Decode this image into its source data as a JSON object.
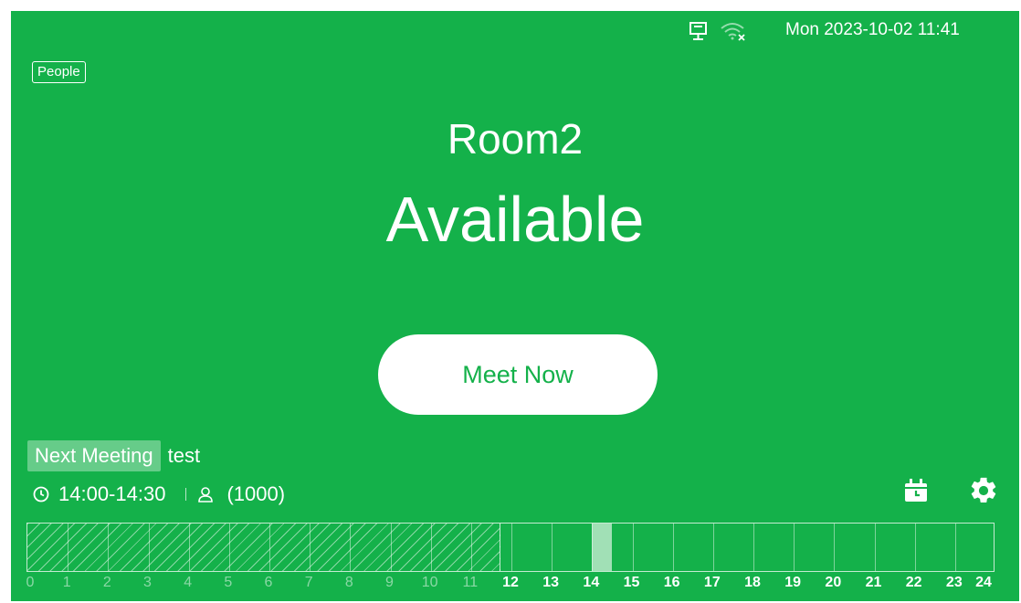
{
  "status": {
    "datetime": "Mon 2023-10-02 11:41",
    "icons": [
      "network-icon",
      "wifi-disconnected-icon"
    ]
  },
  "people_tag": "People",
  "room": {
    "name": "Room2",
    "status": "Available"
  },
  "meet_now_label": "Meet Now",
  "next_meeting": {
    "badge": "Next Meeting",
    "title": "test",
    "time": "14:00-14:30",
    "organizer": "(1000)"
  },
  "actions": {
    "calendar_icon": "calendar-icon",
    "settings_icon": "gear-icon"
  },
  "timeline": {
    "hours": [
      "0",
      "1",
      "2",
      "3",
      "4",
      "5",
      "6",
      "7",
      "8",
      "9",
      "10",
      "11",
      "12",
      "13",
      "14",
      "15",
      "16",
      "17",
      "18",
      "19",
      "20",
      "21",
      "22",
      "23",
      "24"
    ],
    "past_until_hour": 11.7,
    "meetings": [
      {
        "start_hour": 14.0,
        "end_hour": 14.5
      }
    ]
  },
  "colors": {
    "background": "#14b14a",
    "accent": "#ffffff"
  }
}
